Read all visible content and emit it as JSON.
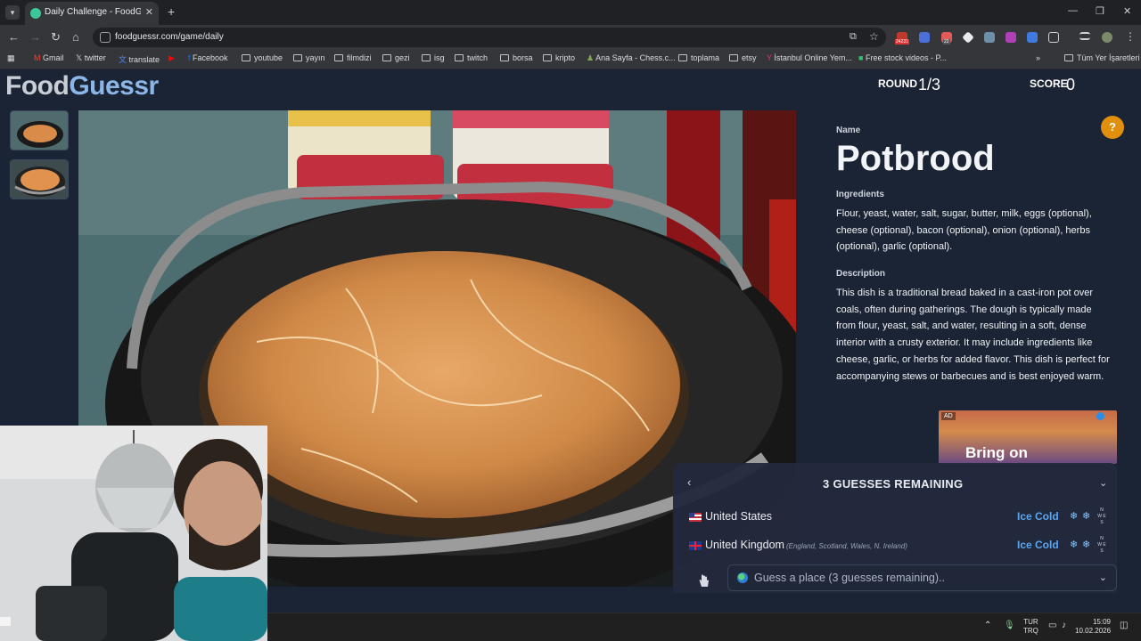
{
  "browser": {
    "tab_title": "Daily Challenge - FoodGuessr |",
    "url": "foodguessr.com/game/daily",
    "bookmarks": [
      {
        "label": "Gmail"
      },
      {
        "label": "twitter"
      },
      {
        "label": "translate"
      },
      {
        "label": ""
      },
      {
        "label": "Facebook"
      },
      {
        "label": "youtube"
      },
      {
        "label": "yayın"
      },
      {
        "label": "filmdizi"
      },
      {
        "label": "gezi"
      },
      {
        "label": "isg"
      },
      {
        "label": "twitch"
      },
      {
        "label": "borsa"
      },
      {
        "label": "kripto"
      },
      {
        "label": "Ana Sayfa - Chess.c..."
      },
      {
        "label": "toplama"
      },
      {
        "label": "etsy"
      },
      {
        "label": "İstanbul Online Yem..."
      },
      {
        "label": "Free stock videos - P..."
      }
    ],
    "bookmarks_more": "»",
    "all_bookmarks": "Tüm Yer İşaretleri",
    "ext_badge_1": "24231",
    "ext_badge_2": "22"
  },
  "game": {
    "logo_part1": "Food",
    "logo_part2": "Guessr",
    "round_label": "ROUND",
    "round_value": "1/3",
    "score_label": "SCORE",
    "score_value": "0"
  },
  "dish": {
    "name_label": "Name",
    "name": "Potbrood",
    "ingredients_label": "Ingredients",
    "ingredients": "Flour, yeast, water, salt, sugar, butter, milk, eggs (optional), cheese (optional), bacon (optional), onion (optional), herbs (optional), garlic (optional).",
    "description_label": "Description",
    "description": "This dish is a traditional bread baked in a cast-iron pot over coals, often during gatherings. The dough is typically made from flour, yeast, salt, and water, resulting in a soft, dense interior with a crusty exterior. It may include ingredients like cheese, garlic, or herbs for added flavor. This dish is perfect for accompanying stews or barbecues and is best enjoyed warm."
  },
  "ad": {
    "tag": "AD",
    "text": "Bring on"
  },
  "guesses": {
    "title": "3 GUESSES REMAINING",
    "rows": [
      {
        "country": "United States",
        "sub": "",
        "temperature": "Ice Cold"
      },
      {
        "country": "United Kingdom",
        "sub": "(England, Scotland, Wales, N. Ireland)",
        "temperature": "Ice Cold"
      }
    ],
    "input_placeholder": "Guess a place (3 guesses remaining).."
  },
  "taskbar": {
    "lang_1": "TUR",
    "lang_2": "TRQ",
    "time": "15:09",
    "date": "10.02.2026"
  },
  "colors": {
    "page_bg": "#1b2435",
    "logo_accent": "#8cb6e8",
    "help_button": "#e0900c",
    "temperature": "#5aa6f2"
  }
}
